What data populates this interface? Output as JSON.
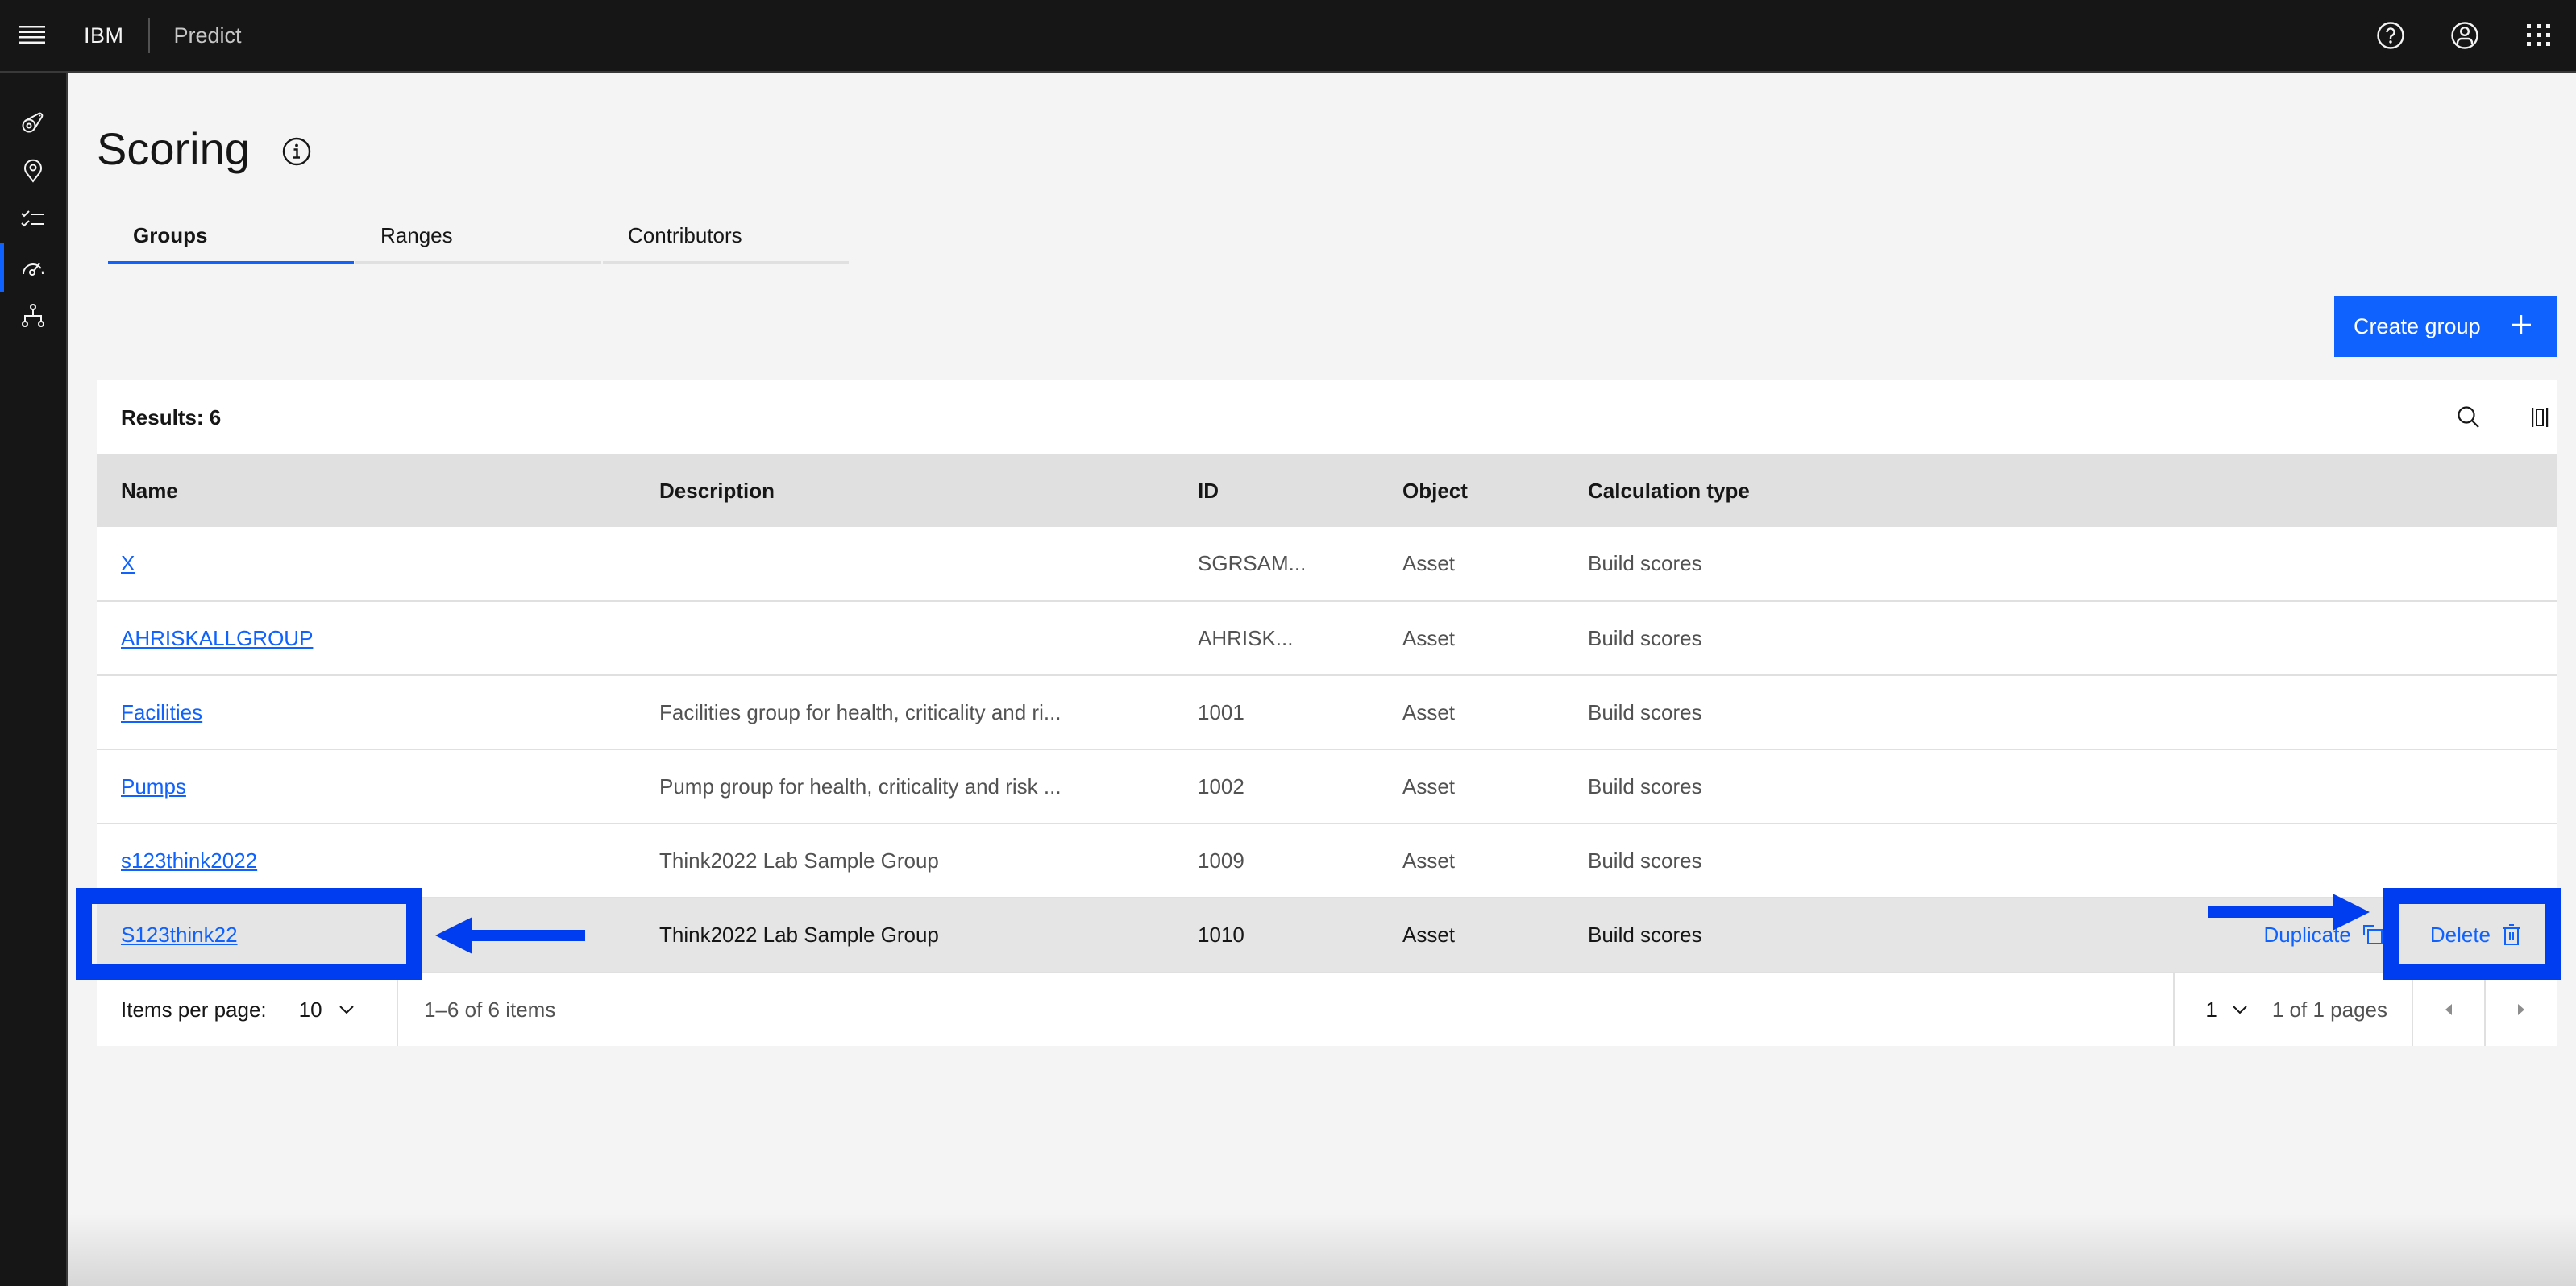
{
  "header": {
    "brand": "IBM",
    "product": "Predict",
    "actions": [
      {
        "icon": "help-icon",
        "label": "Help"
      },
      {
        "icon": "user-avatar-icon",
        "label": "User"
      },
      {
        "icon": "app-switcher-icon",
        "label": "Apps"
      }
    ]
  },
  "sidenav": {
    "items": [
      {
        "icon": "assets-icon",
        "active": false
      },
      {
        "icon": "location-icon",
        "active": false
      },
      {
        "icon": "checklist-icon",
        "active": false
      },
      {
        "icon": "meter-icon",
        "active": true
      },
      {
        "icon": "hierarchy-icon",
        "active": false
      }
    ]
  },
  "page": {
    "title": "Scoring",
    "info_icon": "information-icon"
  },
  "tabs": [
    {
      "label": "Groups",
      "active": true
    },
    {
      "label": "Ranges",
      "active": false
    },
    {
      "label": "Contributors",
      "active": false
    }
  ],
  "create_button": {
    "label": "Create group",
    "icon": "add-icon"
  },
  "table": {
    "results_label": "Results: 6",
    "toolbar_icons": [
      "search-icon",
      "column-settings-icon"
    ],
    "columns": [
      "Name",
      "Description",
      "ID",
      "Object",
      "Calculation type"
    ],
    "rows": [
      {
        "name": "X",
        "description": "",
        "id": "SGRSAM...",
        "object": "Asset",
        "calc": "Build scores"
      },
      {
        "name": "AHRISKALLGROUP",
        "description": "",
        "id": "AHRISK...",
        "object": "Asset",
        "calc": "Build scores"
      },
      {
        "name": "Facilities",
        "description": "Facilities group for health, criticality and ri...",
        "id": "1001",
        "object": "Asset",
        "calc": "Build scores"
      },
      {
        "name": "Pumps",
        "description": "Pump group for health, criticality and risk ...",
        "id": "1002",
        "object": "Asset",
        "calc": "Build scores"
      },
      {
        "name": "s123think2022",
        "description": "Think2022 Lab Sample Group",
        "id": "1009",
        "object": "Asset",
        "calc": "Build scores"
      },
      {
        "name": "S123think22",
        "description": "Think2022 Lab Sample Group",
        "id": "1010",
        "object": "Asset",
        "calc": "Build scores",
        "selected": true
      }
    ],
    "row_actions": {
      "duplicate_label": "Duplicate",
      "delete_label": "Delete"
    }
  },
  "pagination": {
    "items_per_page_label": "Items per page:",
    "items_per_page": "10",
    "range": "1–6 of 6 items",
    "current_page": "1",
    "pages_label": "1 of 1 pages"
  },
  "colors": {
    "accent": "#0f62fe",
    "annotation": "#003cf0",
    "header_bg": "#161616",
    "page_bg": "#f4f4f4"
  }
}
